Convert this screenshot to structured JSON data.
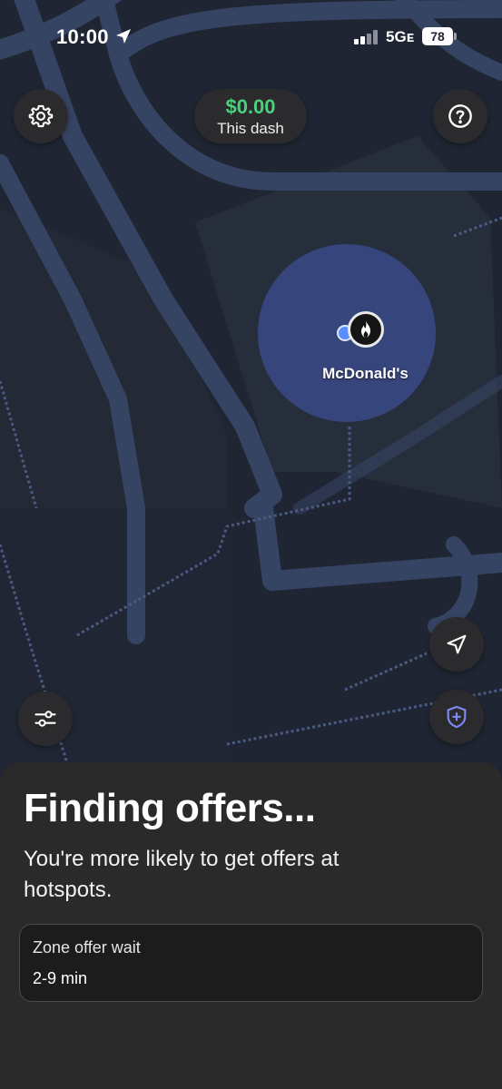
{
  "status_bar": {
    "time": "10:00",
    "network": "5Gᴇ",
    "battery": "78",
    "location_icon": "location-arrow-icon",
    "signal_icon": "cellular-signal-icon"
  },
  "header": {
    "earnings_amount": "$0.00",
    "earnings_label": "This dash",
    "earnings_color": "#4cd07d",
    "settings_icon": "gear-icon",
    "help_icon": "question-mark-icon"
  },
  "map": {
    "hotspot_label": "McDonald's",
    "hotspot_icon": "flame-icon",
    "hotspot_color": "#3a4a8a",
    "background_color": "#1e2430",
    "road_color": "#3a4a6e",
    "controls": {
      "filter_icon": "sliders-icon",
      "recenter_icon": "navigation-arrow-icon",
      "safety_icon": "shield-plus-icon"
    }
  },
  "sheet": {
    "title": "Finding offers...",
    "subtitle": "You're more likely to get offers at hotspots.",
    "wait_label": "Zone offer wait",
    "wait_value": "2-9 min"
  }
}
